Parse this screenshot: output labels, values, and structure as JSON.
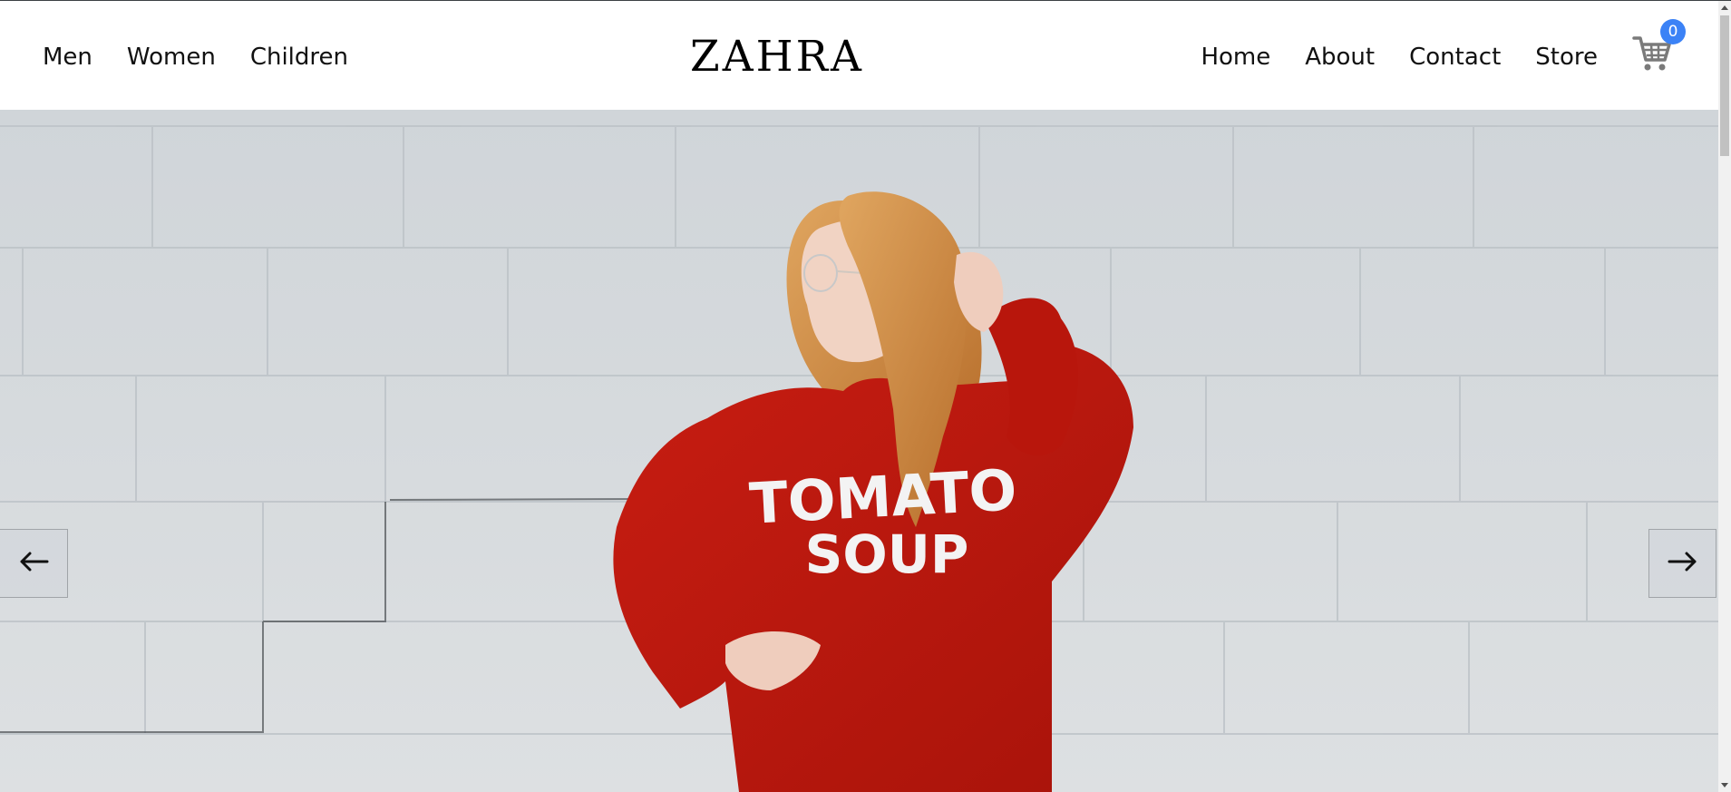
{
  "header": {
    "nav_left": [
      "Men",
      "Women",
      "Children"
    ],
    "logo": "ZAHRA",
    "nav_right": [
      "Home",
      "About",
      "Contact",
      "Store"
    ],
    "cart": {
      "icon": "shopping-cart-icon",
      "count": "0",
      "badge_color": "#3b82f6"
    }
  },
  "hero": {
    "sweater_text_line1": "TOMATO",
    "sweater_text_line2": "SOUP",
    "prev_icon": "arrow-left-icon",
    "next_icon": "arrow-right-icon",
    "wall_color": "#d6dadd",
    "sweater_color": "#c0180f",
    "hair_color": "#d99a4e"
  }
}
